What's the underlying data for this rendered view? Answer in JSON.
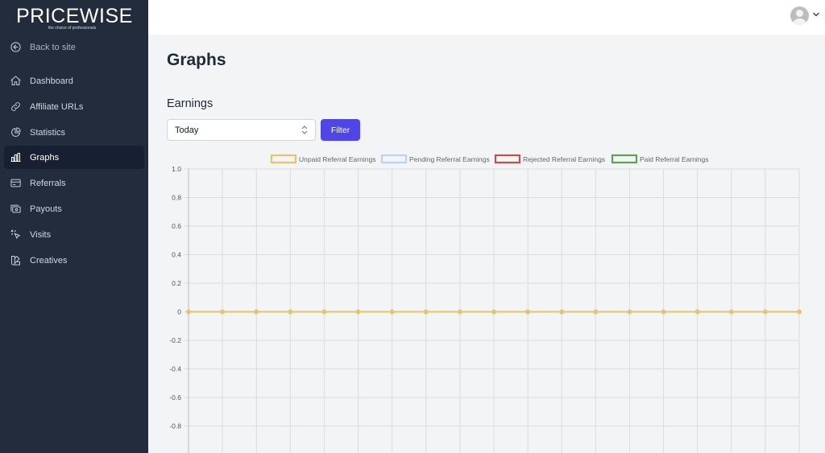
{
  "brand": {
    "name": "PRICEWISE",
    "tagline": "the choice of professionals"
  },
  "sidebar": {
    "back_label": "Back to site",
    "items": [
      {
        "label": "Dashboard",
        "icon": "home-icon"
      },
      {
        "label": "Affiliate URLs",
        "icon": "link-icon"
      },
      {
        "label": "Statistics",
        "icon": "pie-chart-icon"
      },
      {
        "label": "Graphs",
        "icon": "bar-chart-icon",
        "active": true
      },
      {
        "label": "Referrals",
        "icon": "credit-card-icon"
      },
      {
        "label": "Payouts",
        "icon": "cash-icon"
      },
      {
        "label": "Visits",
        "icon": "cursor-click-icon"
      },
      {
        "label": "Creatives",
        "icon": "swatch-icon"
      }
    ]
  },
  "header": {
    "avatar_icon": "user-avatar-icon"
  },
  "main": {
    "title": "Graphs",
    "section_title": "Earnings",
    "period_select": {
      "value": "Today"
    },
    "filter_label": "Filter"
  },
  "colors": {
    "accent": "#5046e5",
    "sidebar": "#222c3d",
    "unpaid": "#e5c46b",
    "pending": "#b9d3f5",
    "rejected": "#c0504d",
    "paid": "#5aa454"
  },
  "chart_data": {
    "type": "line",
    "legend": [
      "Unpaid Referral Earnings",
      "Pending Referral Earnings",
      "Rejected Referral Earnings",
      "Paid Referral Earnings"
    ],
    "legend_position": "top",
    "x_count": 19,
    "series": [
      {
        "name": "Unpaid Referral Earnings",
        "color": "#e5c46b",
        "values": [
          0,
          0,
          0,
          0,
          0,
          0,
          0,
          0,
          0,
          0,
          0,
          0,
          0,
          0,
          0,
          0,
          0,
          0,
          0
        ]
      }
    ],
    "yticks": [
      "1.0",
      "0.8",
      "0.6",
      "0.4",
      "0.2",
      "0",
      "-0.2",
      "-0.4",
      "-0.6",
      "-0.8"
    ],
    "ylim": [
      -1,
      1
    ],
    "grid": true
  }
}
